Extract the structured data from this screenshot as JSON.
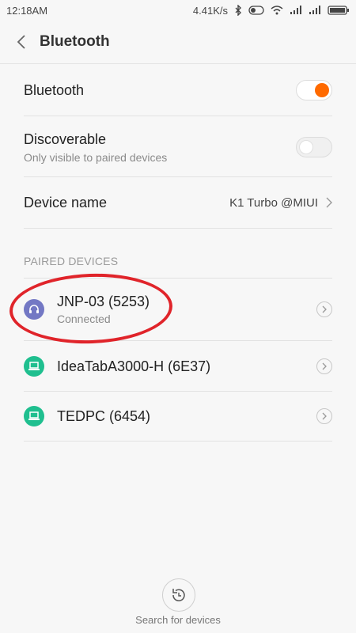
{
  "status": {
    "time": "12:18AM",
    "speed": "4.41K/s"
  },
  "appbar": {
    "title": "Bluetooth"
  },
  "settings": {
    "bluetooth": {
      "label": "Bluetooth",
      "enabled": true
    },
    "discoverable": {
      "label": "Discoverable",
      "sub": "Only visible to paired devices",
      "enabled": false
    },
    "device_name": {
      "label": "Device name",
      "value": "K1 Turbo @MIUI"
    }
  },
  "paired": {
    "header": "PAIRED DEVICES",
    "devices": [
      {
        "name": "JNP-03 (5253)",
        "status": "Connected",
        "icon": "headset-icon",
        "color": "#7378c4"
      },
      {
        "name": "IdeaTabA3000-H (6E37)",
        "icon": "laptop-icon",
        "color": "#1fbf8f"
      },
      {
        "name": "TEDPC (6454)",
        "icon": "laptop-icon",
        "color": "#1fbf8f"
      }
    ]
  },
  "footer": {
    "search_label": "Search for devices"
  },
  "colors": {
    "accent": "#ff6a00",
    "annotation": "#e0242a"
  }
}
